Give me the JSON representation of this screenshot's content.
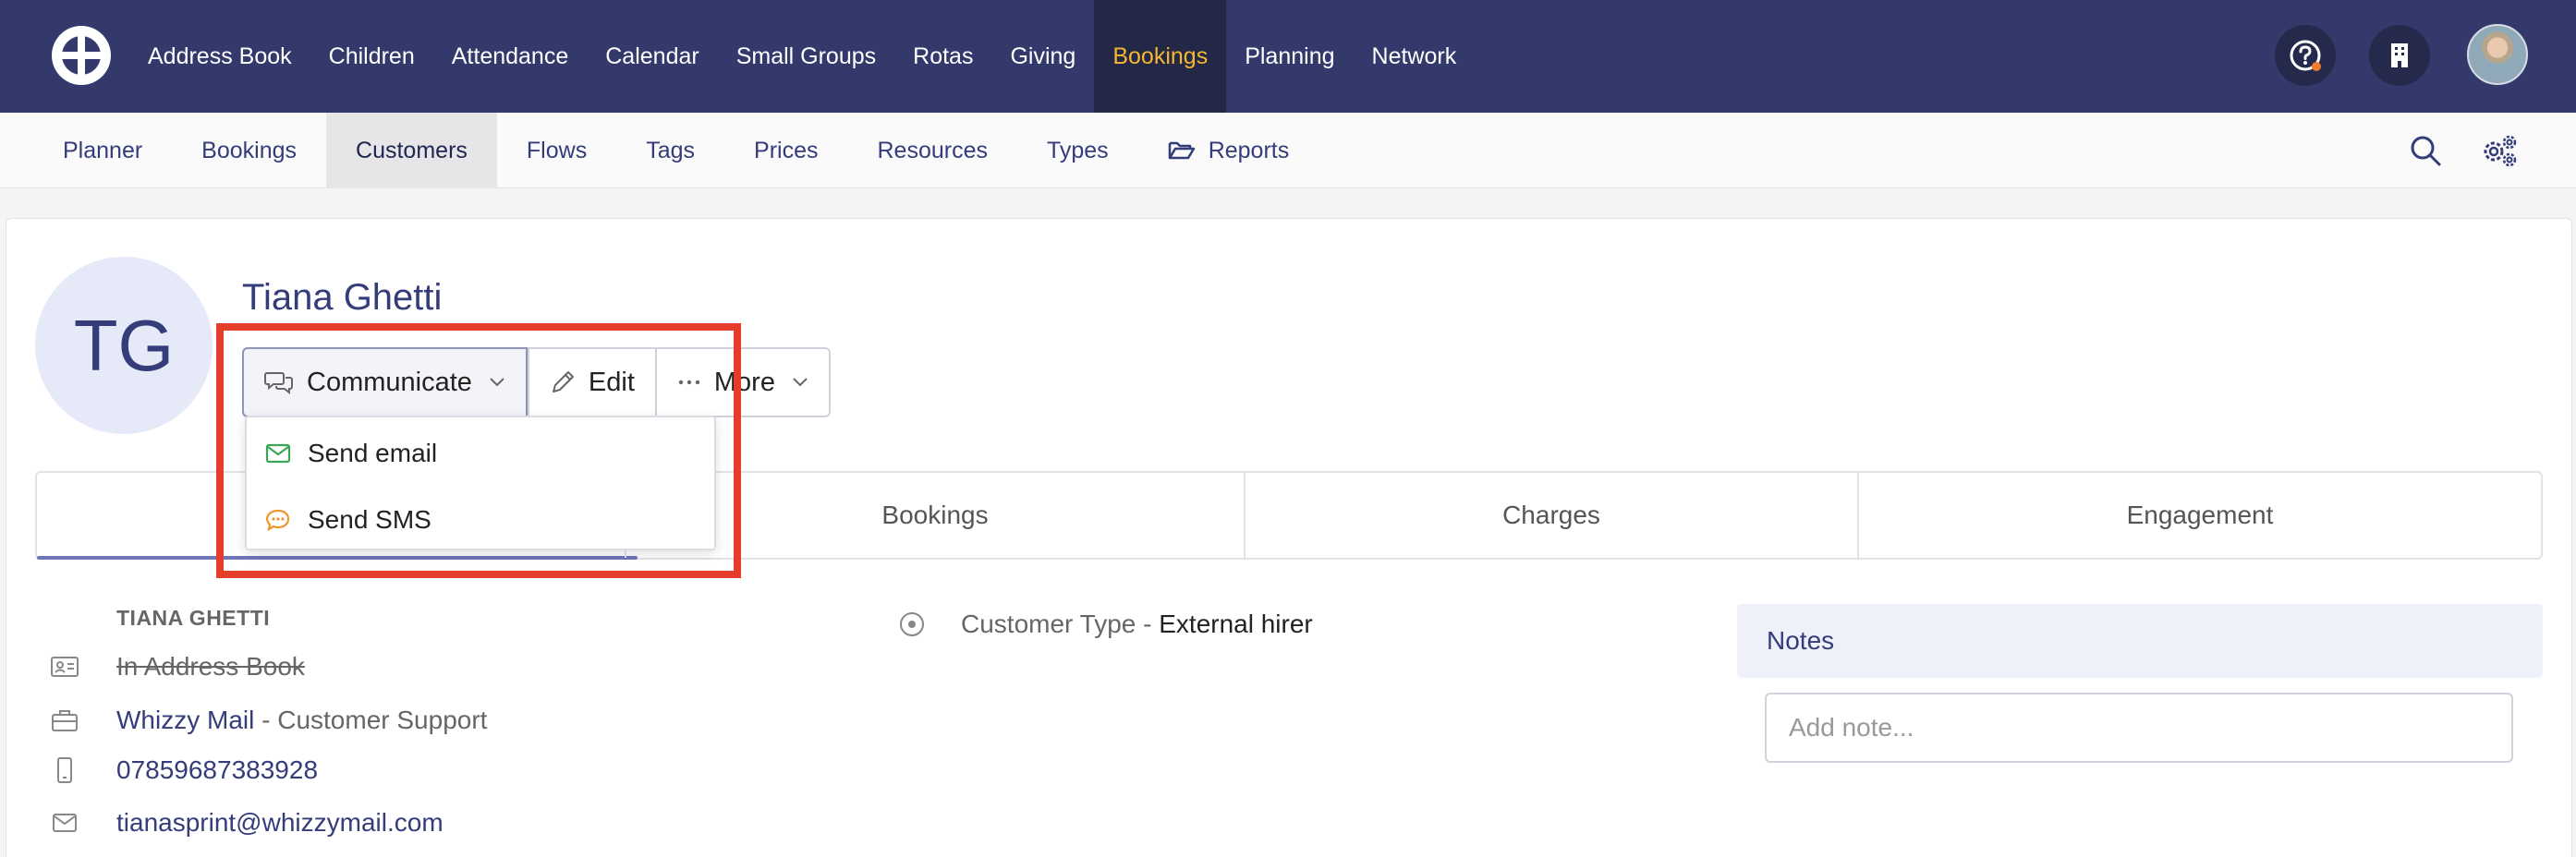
{
  "topnav": {
    "items": [
      {
        "label": "Address Book"
      },
      {
        "label": "Children"
      },
      {
        "label": "Attendance"
      },
      {
        "label": "Calendar"
      },
      {
        "label": "Small Groups"
      },
      {
        "label": "Rotas"
      },
      {
        "label": "Giving"
      },
      {
        "label": "Bookings",
        "active": true
      },
      {
        "label": "Planning"
      },
      {
        "label": "Network"
      }
    ],
    "active_color": "#f5b731",
    "background": "#333a6b"
  },
  "subnav": {
    "items": [
      {
        "label": "Planner"
      },
      {
        "label": "Bookings"
      },
      {
        "label": "Customers",
        "active": true
      },
      {
        "label": "Flows"
      },
      {
        "label": "Tags"
      },
      {
        "label": "Prices"
      },
      {
        "label": "Resources"
      },
      {
        "label": "Types"
      },
      {
        "label": "Reports",
        "icon": "folder-open-icon"
      }
    ]
  },
  "customer": {
    "initials": "TG",
    "name": "Tiana Ghetti",
    "details_heading": "TIANA GHETTI",
    "address_book": "In Address Book",
    "organisation": "Whizzy Mail",
    "role": "Customer Support",
    "role_separator": " - ",
    "phone": "07859687383928",
    "email": "tianasprint@whizzymail.com",
    "customer_type_label": "Customer Type - ",
    "customer_type_value": "External hirer"
  },
  "actions": {
    "communicate": "Communicate",
    "edit": "Edit",
    "more": "More"
  },
  "communicate_menu": {
    "send_email": "Send email",
    "send_sms": "Send SMS"
  },
  "tabs": {
    "bookings": "Bookings",
    "charges": "Charges",
    "engagement": "Engagement"
  },
  "notes": {
    "title": "Notes",
    "placeholder": "Add note..."
  }
}
